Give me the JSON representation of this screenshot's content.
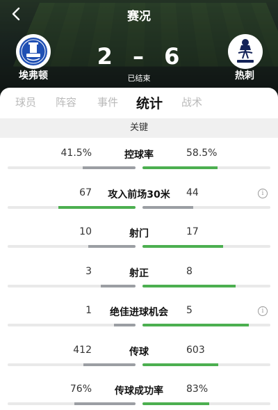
{
  "header": {
    "back_glyph": "‹",
    "title": "赛况",
    "score_home": "2",
    "score_sep": "–",
    "score_away": "6",
    "status": "已结束",
    "home_team": "埃弗顿",
    "away_team": "热刺",
    "home_crest_icon": "everton-crest-icon",
    "away_crest_icon": "tottenham-crest-icon"
  },
  "tabs": [
    {
      "label": "球员",
      "active": false
    },
    {
      "label": "阵容",
      "active": false
    },
    {
      "label": "事件",
      "active": false
    },
    {
      "label": "统计",
      "active": true
    },
    {
      "label": "战术",
      "active": false
    }
  ],
  "section": {
    "title": "关键"
  },
  "stats": [
    {
      "label": "控球率",
      "home": "41.5%",
      "away": "58.5%",
      "home_value": 41.5,
      "away_value": 58.5,
      "info": false
    },
    {
      "label": "攻入前场30米",
      "home": "67",
      "away": "44",
      "home_value": 67,
      "away_value": 44,
      "info": true
    },
    {
      "label": "射门",
      "home": "10",
      "away": "17",
      "home_value": 10,
      "away_value": 17,
      "info": false
    },
    {
      "label": "射正",
      "home": "3",
      "away": "8",
      "home_value": 3,
      "away_value": 8,
      "info": false
    },
    {
      "label": "绝佳进球机会",
      "home": "1",
      "away": "5",
      "home_value": 1,
      "away_value": 5,
      "info": true
    },
    {
      "label": "传球",
      "home": "412",
      "away": "603",
      "home_value": 412,
      "away_value": 603,
      "info": false
    },
    {
      "label": "传球成功率",
      "home": "76%",
      "away": "83%",
      "home_value": 76,
      "away_value": 83,
      "info": false
    }
  ],
  "info_glyph": "i",
  "colors": {
    "win": "#4caf50",
    "lose": "#9b9ea3",
    "track": "#e9e9e9"
  }
}
